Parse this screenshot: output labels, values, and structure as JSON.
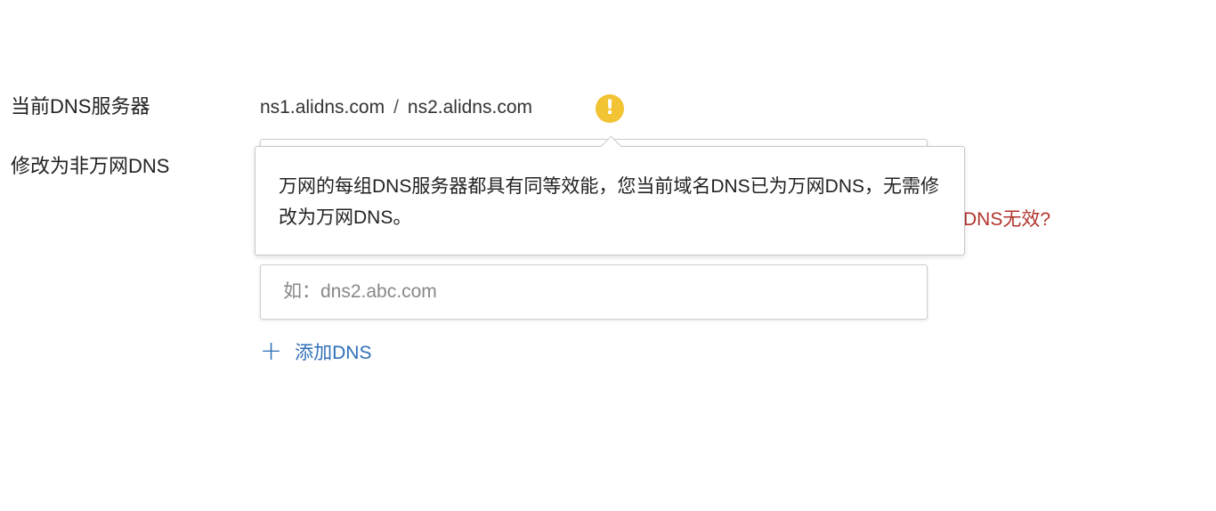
{
  "form": {
    "current_dns_label": "当前DNS服务器",
    "current_dns_servers": [
      "ns1.alidns.com",
      "ns2.alidns.com"
    ],
    "separator": "/",
    "change_dns_label": "修改为非万网DNS",
    "dns_input_1": {
      "value": "",
      "placeholder": ""
    },
    "dns_input_2": {
      "value": "",
      "placeholder": "如：dns2.abc.com"
    },
    "invalid_link_text": "提示DNS无效?",
    "add_dns_label": "添加DNS",
    "add_icon": "plus-icon",
    "warning_icon": "exclamation-icon",
    "warning_color": "#f2c332",
    "link_color": "#2e6fb8",
    "error_color": "#b2332b"
  },
  "tooltip": {
    "text": "万网的每组DNS服务器都具有同等效能，您当前域名DNS已为万网DNS，无需修改为万网DNS。"
  }
}
